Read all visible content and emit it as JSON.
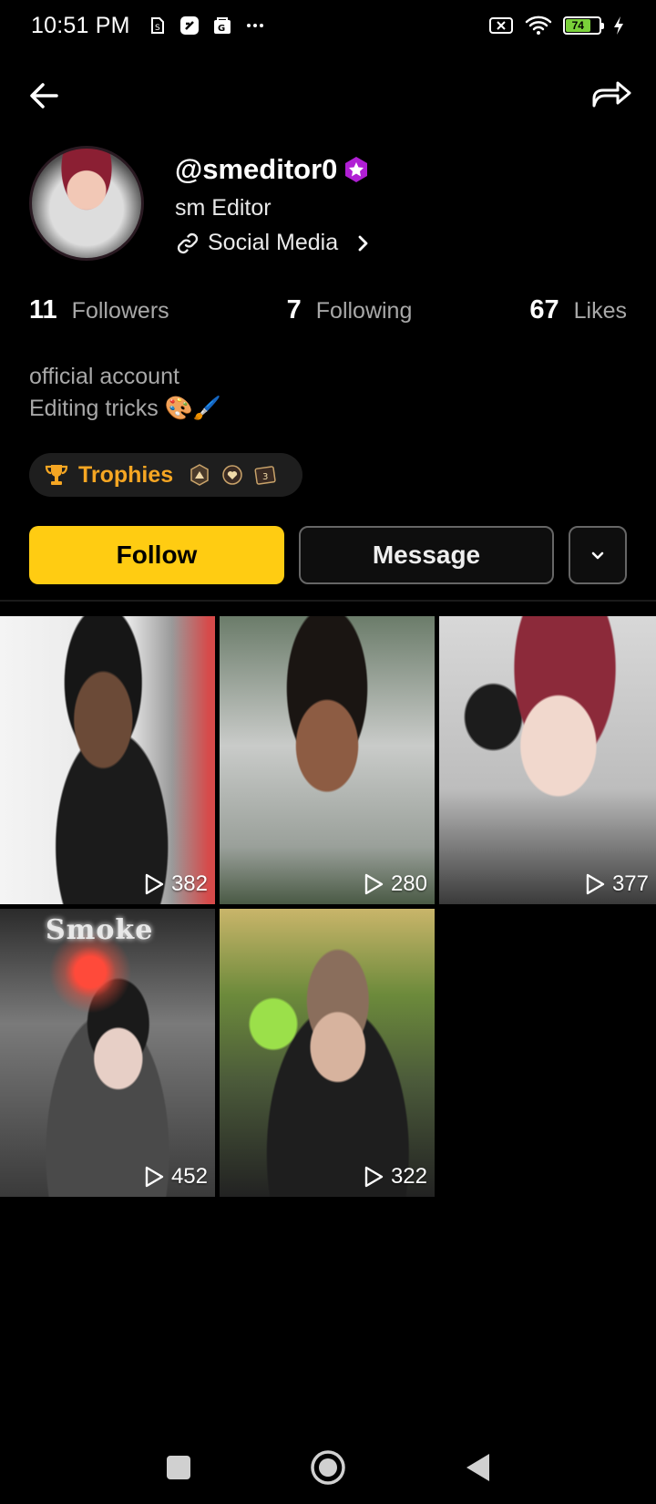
{
  "status_bar": {
    "time": "10:51 PM",
    "battery_level": "74"
  },
  "nav": {
    "back_icon": "arrow-left-icon",
    "share_icon": "share-icon"
  },
  "profile": {
    "username": "@smeditor0",
    "display_name": "sm Editor",
    "link_text": "Social Media",
    "bio_line1": "official account",
    "bio_line2": "Editing tricks 🎨🖌️"
  },
  "stats": {
    "followers_count": "11",
    "followers_label": "Followers",
    "following_count": "7",
    "following_label": "Following",
    "likes_count": "67",
    "likes_label": "Likes"
  },
  "trophies": {
    "label": "Trophies"
  },
  "actions": {
    "follow_label": "Follow",
    "message_label": "Message"
  },
  "videos": [
    {
      "plays": "382"
    },
    {
      "plays": "280"
    },
    {
      "plays": "377"
    },
    {
      "plays": "452",
      "overlay_text": "Smoke"
    },
    {
      "plays": "322"
    }
  ],
  "colors": {
    "accent": "#ffcc12",
    "trophy": "#f5a623",
    "badge": "#b01fd4"
  }
}
